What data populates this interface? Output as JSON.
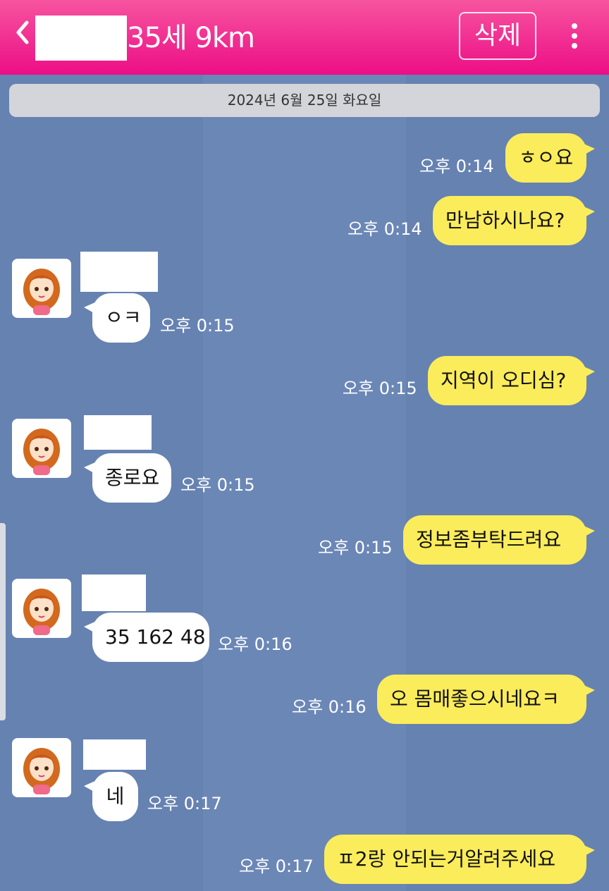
{
  "header": {
    "back_icon": "chevron-left",
    "title": "35세 9km",
    "delete_label": "삭제",
    "menu_icon": "more-vertical"
  },
  "date_divider": "2024년 6월 25일 화요일",
  "colors": {
    "header": "#ee1d8c",
    "background": "#6682b1",
    "my_bubble": "#fbec5b",
    "their_bubble": "#ffffff"
  },
  "messages": [
    {
      "sender": "me",
      "text": "ㅎㅇ요",
      "time": "오후 0:14"
    },
    {
      "sender": "me",
      "text": "만남하시나요?",
      "time": "오후 0:14"
    },
    {
      "sender": "them",
      "text": "ㅇㅋ",
      "time": "오후 0:15"
    },
    {
      "sender": "me",
      "text": "지역이 오디심?",
      "time": "오후 0:15"
    },
    {
      "sender": "them",
      "text": "종로요",
      "time": "오후 0:15"
    },
    {
      "sender": "me",
      "text": "정보좀부탁드려요",
      "time": "오후 0:15"
    },
    {
      "sender": "them",
      "text": "35 162 48",
      "time": "오후 0:16"
    },
    {
      "sender": "me",
      "text": "오 몸매좋으시네요ㅋ",
      "time": "오후 0:16"
    },
    {
      "sender": "them",
      "text": "네",
      "time": "오후 0:17"
    },
    {
      "sender": "me",
      "text": "ㅍ2랑 안되는거알려주세요",
      "time": "오후 0:17"
    }
  ]
}
